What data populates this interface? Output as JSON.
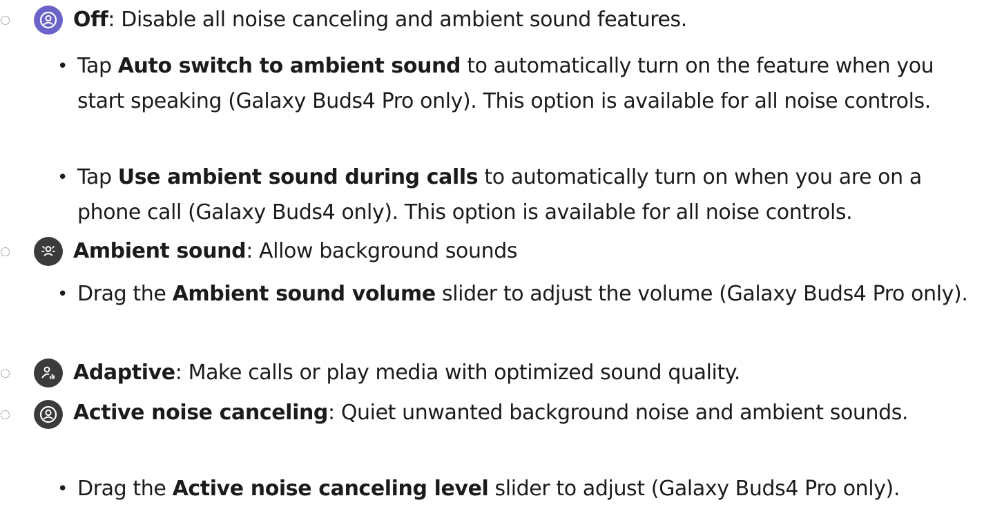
{
  "colors": {
    "off_icon": "#6c63c9",
    "dark_icon": "#3b3b3b"
  },
  "items": [
    {
      "icon": "person-icon",
      "title": "Off",
      "text": ": Disable all noise canceling and ambient sound features.",
      "subs": [
        {
          "pre": "Tap ",
          "bold": "Auto switch to ambient sound",
          "post": " to automatically turn on the feature when you start speaking (Galaxy Buds4 Pro only). This option is available for all noise controls."
        },
        {
          "pre": "Tap ",
          "bold": "Use ambient sound during calls",
          "post": " to automatically turn on when you are on a phone call (Galaxy Buds4 only). This option is available for all noise controls."
        }
      ]
    },
    {
      "icon": "ambient-person-icon",
      "title": "Ambient sound",
      "text": ": Allow background sounds",
      "subs": [
        {
          "pre": "Drag the ",
          "bold": "Ambient sound volume",
          "post": " slider to adjust the volume (Galaxy Buds4 Pro only)."
        }
      ]
    },
    {
      "icon": "adaptive-sound-icon",
      "title": "Adaptive",
      "text": ": Make calls or play media with optimized sound quality.",
      "subs": []
    },
    {
      "icon": "noise-cancel-person-icon",
      "title": "Active noise canceling",
      "text": ": Quiet unwanted background noise and ambient sounds.",
      "subs": [
        {
          "pre": "Drag the ",
          "bold": "Active noise canceling level",
          "post": " slider to adjust (Galaxy Buds4 Pro only)."
        }
      ]
    }
  ]
}
